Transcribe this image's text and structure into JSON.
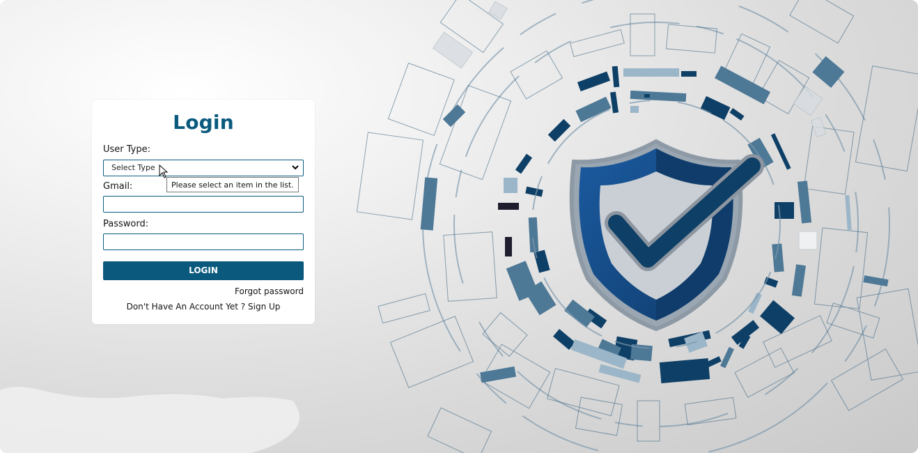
{
  "login": {
    "title": "Login",
    "user_type_label": "User Type:",
    "user_type_select": "Select Type",
    "gmail_label": "Gmail:",
    "gmail_value": "",
    "password_label": "Password:",
    "password_value": "",
    "login_button": "LOGIN",
    "forgot_password": "Forgot password",
    "no_account_text": "Don't Have An Account Yet ?",
    "sign_up": "Sign Up"
  },
  "tooltip": {
    "text": "Please select an item in the list."
  },
  "icons": {
    "select_arrow": "chevron-down-icon",
    "cursor": "mouse-pointer-icon",
    "shield": "shield-check-icon"
  },
  "colors": {
    "accent": "#0b5a7e",
    "shield_dark": "#0f3c6b",
    "shield_light": "#1b5aa0",
    "ring_dark": "#0e3f66",
    "ring_mid": "#4d7896",
    "ring_light": "#9bb6c8"
  }
}
